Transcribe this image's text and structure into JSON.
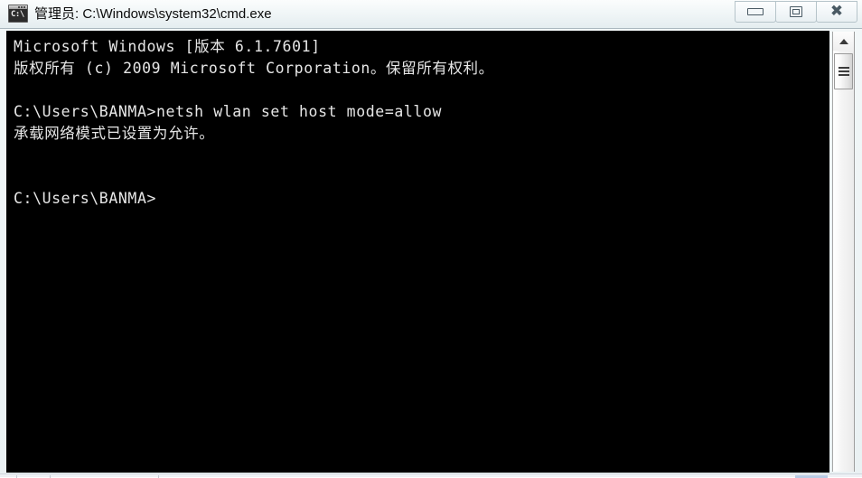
{
  "window": {
    "title": "管理员: C:\\Windows\\system32\\cmd.exe",
    "icon_name": "cmd-exe-icon",
    "icon_text": "C:\\",
    "background_color": "#000000",
    "text_color": "#e6e6e6"
  },
  "caption_buttons": {
    "minimize_label": "—",
    "maximize_label": "❐",
    "close_label": "✖"
  },
  "console": {
    "lines": [
      "Microsoft Windows [版本 6.1.7601]",
      "版权所有 (c) 2009 Microsoft Corporation。保留所有权利。",
      "",
      "C:\\Users\\BANMA>netsh wlan set host mode=allow",
      "承载网络模式已设置为允许。",
      "",
      "",
      "C:\\Users\\BANMA>"
    ]
  },
  "scrollbar": {
    "up_arrow": "▲",
    "thumb_position_percent": 5
  }
}
